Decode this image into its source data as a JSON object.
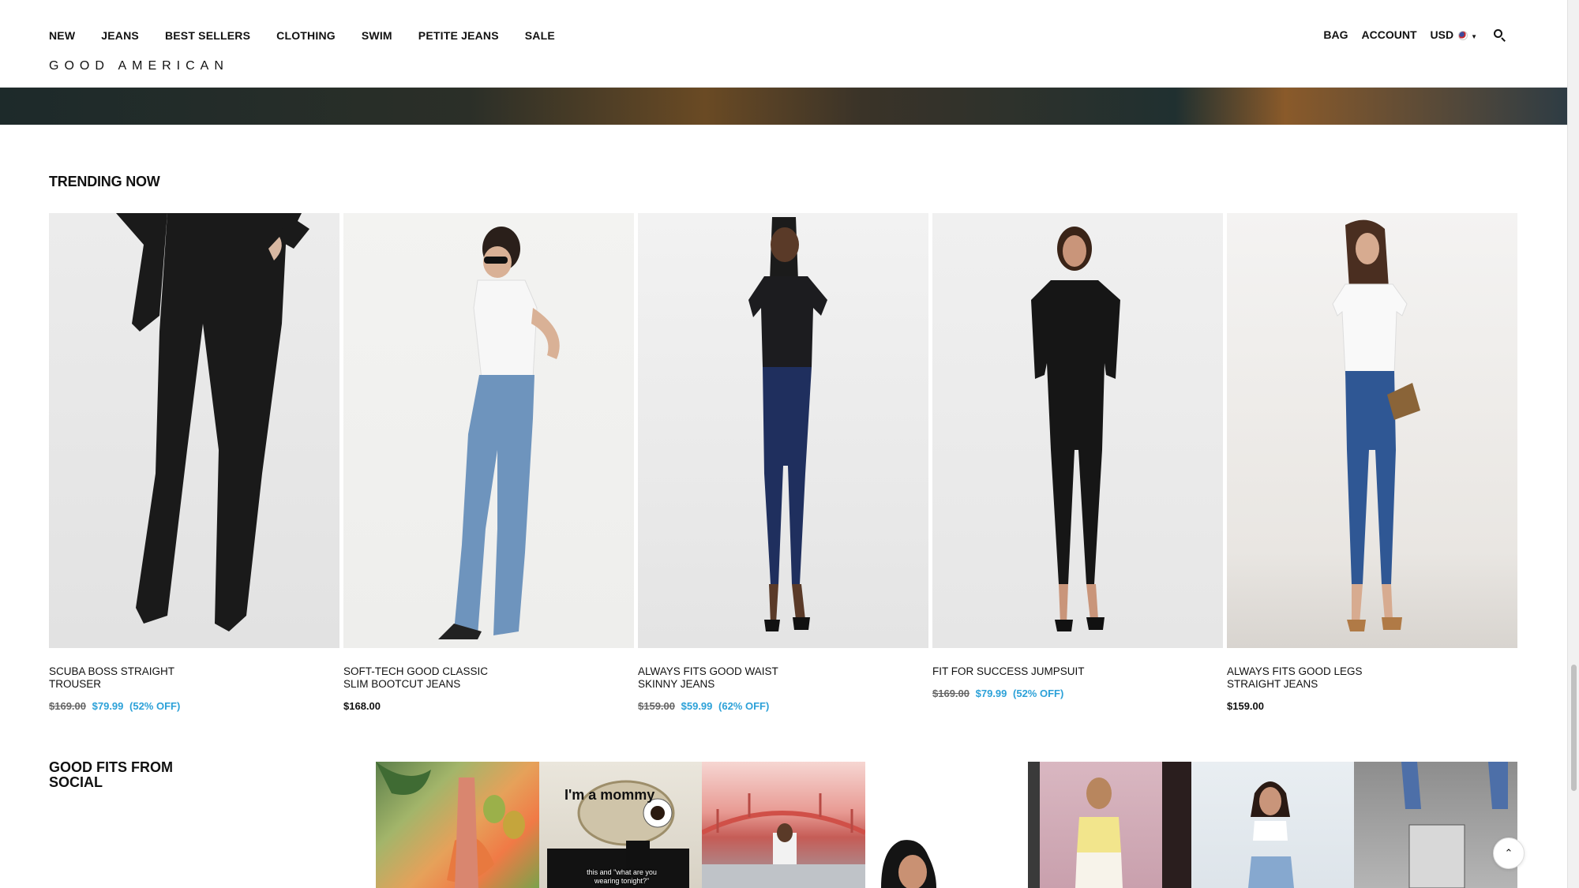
{
  "nav": {
    "items": [
      "NEW",
      "JEANS",
      "BEST SELLERS",
      "CLOTHING",
      "SWIM",
      "PETITE JEANS",
      "SALE"
    ],
    "logo": "GOOD AMERICAN",
    "bag": "BAG",
    "account": "ACCOUNT",
    "currency": "USD"
  },
  "trending": {
    "title": "TRENDING NOW",
    "products": [
      {
        "name": "SCUBA BOSS STRAIGHT TROUSER",
        "original": "$169.00",
        "sale": "$79.99",
        "off": "(52% OFF)"
      },
      {
        "name": "SOFT-TECH GOOD CLASSIC SLIM BOOTCUT JEANS",
        "price": "$168.00"
      },
      {
        "name": "ALWAYS FITS GOOD WAIST SKINNY JEANS",
        "original": "$159.00",
        "sale": "$59.99",
        "off": "(62% OFF)"
      },
      {
        "name": "FIT FOR SUCCESS JUMPSUIT",
        "original": "$169.00",
        "sale": "$79.99",
        "off": "(52% OFF)"
      },
      {
        "name": "ALWAYS FITS GOOD LEGS STRAIGHT JEANS",
        "price": "$159.00"
      }
    ]
  },
  "social": {
    "title": "GOOD FITS FROM SOCIAL",
    "caption": "this and \"what are you wearing tonight?\"",
    "overlay": "I'm a mommy"
  },
  "colors": {
    "accent_sale": "#2ca1d8",
    "text": "#111111"
  }
}
